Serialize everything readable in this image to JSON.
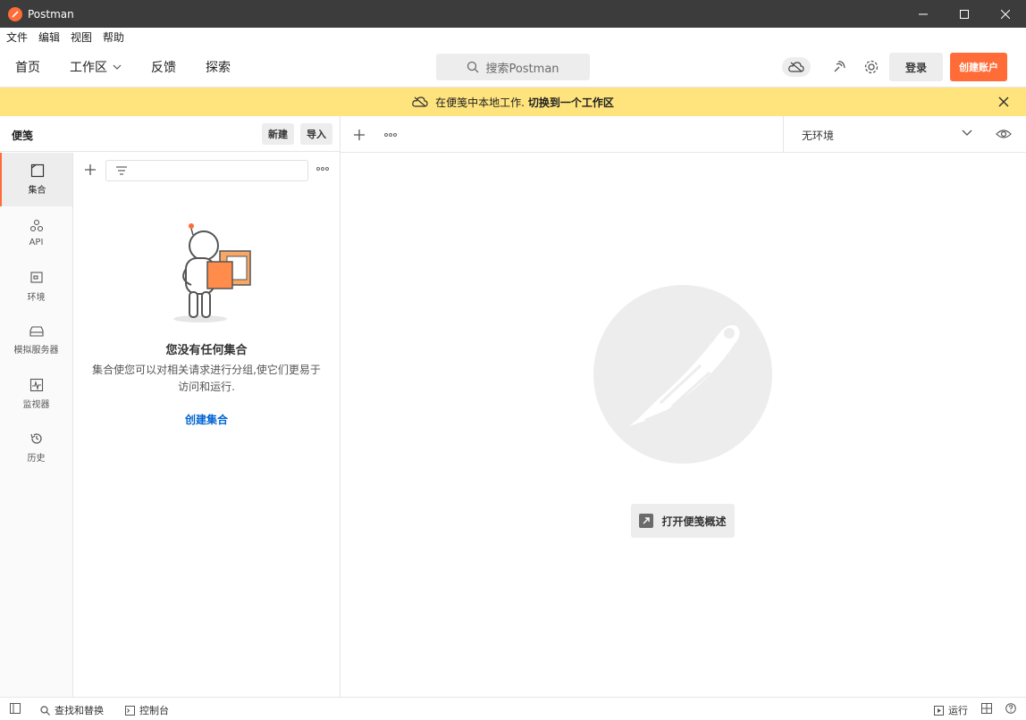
{
  "window": {
    "title": "Postman"
  },
  "menu": [
    "文件",
    "编辑",
    "视图",
    "帮助"
  ],
  "header": {
    "nav": {
      "home": "首页",
      "workspaces": "工作区",
      "feedback": "反馈",
      "explore": "探索"
    },
    "search_placeholder": "搜索Postman",
    "login": "登录",
    "signup": "创建账户"
  },
  "banner": {
    "text": "在便笺中本地工作.",
    "action": "切换到一个工作区"
  },
  "sidebar": {
    "title": "便笺",
    "new_button": "新建",
    "import_button": "导入",
    "rail": [
      {
        "label": "集合",
        "icon": "collection-icon"
      },
      {
        "label": "API",
        "icon": "api-icon"
      },
      {
        "label": "环境",
        "icon": "environment-icon"
      },
      {
        "label": "模拟服务器",
        "icon": "mock-server-icon"
      },
      {
        "label": "监视器",
        "icon": "monitor-icon"
      },
      {
        "label": "历史",
        "icon": "history-icon"
      }
    ],
    "empty": {
      "title": "您没有任何集合",
      "description": "集合使您可以对相关请求进行分组,使它们更易于访问和运行.",
      "create_link": "创建集合"
    }
  },
  "environment": {
    "selected": "无环境"
  },
  "workspace": {
    "open_overview": "打开便笺概述"
  },
  "statusbar": {
    "find_replace": "查找和替换",
    "console": "控制台",
    "runner": "运行"
  },
  "colors": {
    "accent": "#ff6c37",
    "banner": "#ffe47e",
    "link": "#0265d2"
  }
}
